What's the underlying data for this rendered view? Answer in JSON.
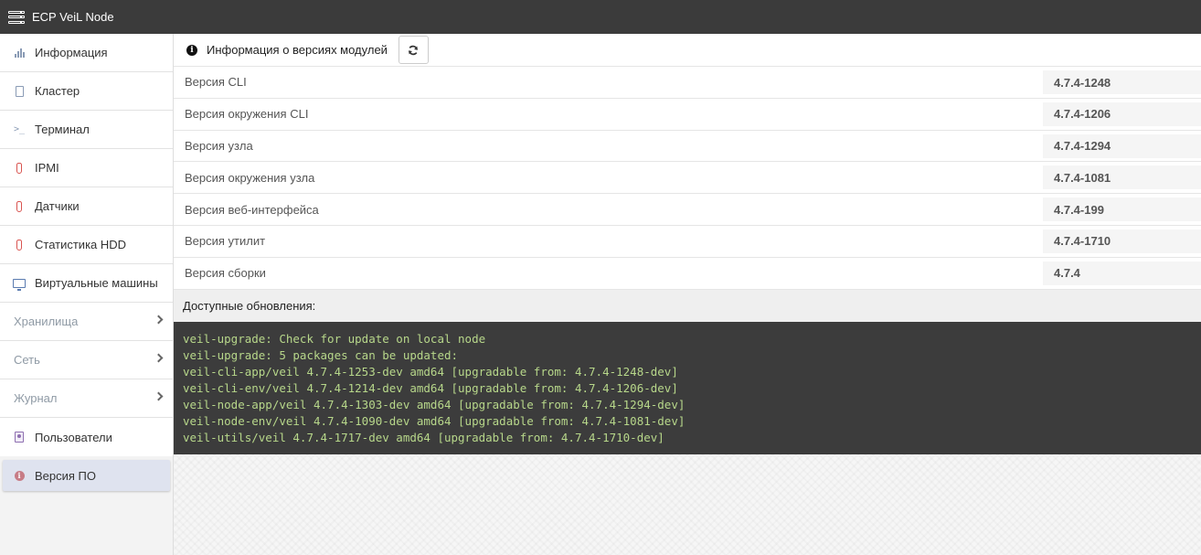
{
  "app": {
    "title": "ECP VeiL Node"
  },
  "sidebar": {
    "items": [
      {
        "label": "Информация"
      },
      {
        "label": "Кластер"
      },
      {
        "label": "Терминал"
      },
      {
        "label": "IPMI"
      },
      {
        "label": "Датчики"
      },
      {
        "label": "Статистика HDD"
      },
      {
        "label": "Виртуальные машины"
      },
      {
        "label": "Хранилища"
      },
      {
        "label": "Сеть"
      },
      {
        "label": "Журнал"
      },
      {
        "label": "Пользователи"
      },
      {
        "label": "Версия ПО"
      }
    ]
  },
  "panel": {
    "title": "Информация о версиях модулей",
    "versions": [
      {
        "label": "Версия CLI",
        "value": "4.7.4-1248"
      },
      {
        "label": "Версия окружения CLI",
        "value": "4.7.4-1206"
      },
      {
        "label": "Версия узла",
        "value": "4.7.4-1294"
      },
      {
        "label": "Версия окружения узла",
        "value": "4.7.4-1081"
      },
      {
        "label": "Версия веб-интерфейса",
        "value": "4.7.4-199"
      },
      {
        "label": "Версия утилит",
        "value": "4.7.4-1710"
      },
      {
        "label": "Версия сборки",
        "value": "4.7.4"
      }
    ],
    "updates_label": "Доступные обновления:",
    "console_lines": [
      "veil-upgrade: Check for update on local node",
      "veil-upgrade: 5 packages can be updated:",
      "veil-cli-app/veil 4.7.4-1253-dev amd64 [upgradable from: 4.7.4-1248-dev]",
      "veil-cli-env/veil 4.7.4-1214-dev amd64 [upgradable from: 4.7.4-1206-dev]",
      "veil-node-app/veil 4.7.4-1303-dev amd64 [upgradable from: 4.7.4-1294-dev]",
      "veil-node-env/veil 4.7.4-1090-dev amd64 [upgradable from: 4.7.4-1081-dev]",
      "veil-utils/veil 4.7.4-1717-dev amd64 [upgradable from: 4.7.4-1710-dev]"
    ]
  },
  "colors": {
    "topbar": "#3b3b3b",
    "console_bg": "#3c3c3c",
    "console_text": "#b7d78a",
    "active_item": "#dfe3ef"
  }
}
